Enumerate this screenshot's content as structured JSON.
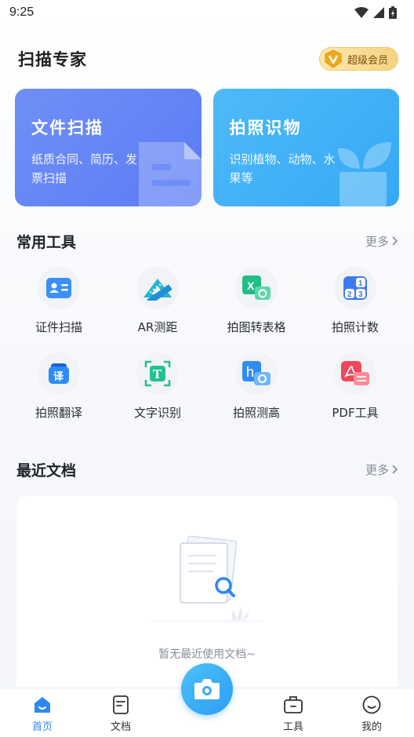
{
  "status_bar": {
    "time": "9:25"
  },
  "header": {
    "title": "扫描专家",
    "vip_label": "超级会员",
    "vip_icon": "v-badge-icon"
  },
  "hero": [
    {
      "title": "文件扫描",
      "desc": "纸质合同、简历、发票扫描"
    },
    {
      "title": "拍照识物",
      "desc": "识别植物、动物、水果等"
    }
  ],
  "tools_section": {
    "title": "常用工具",
    "more": "更多",
    "items": [
      {
        "label": "证件扫描",
        "icon": "id-card-icon"
      },
      {
        "label": "AR测距",
        "icon": "ruler-icon"
      },
      {
        "label": "拍图转表格",
        "icon": "excel-icon"
      },
      {
        "label": "拍照计数",
        "icon": "number-grid-icon"
      },
      {
        "label": "拍照翻译",
        "icon": "translate-icon"
      },
      {
        "label": "文字识别",
        "icon": "text-scan-icon"
      },
      {
        "label": "拍照测高",
        "icon": "height-icon"
      },
      {
        "label": "PDF工具",
        "icon": "pdf-icon"
      }
    ]
  },
  "recent_section": {
    "title": "最近文档",
    "more": "更多",
    "empty_text": "暂无最近使用文档~"
  },
  "tab_bar": {
    "items": [
      {
        "label": "首页",
        "active": true
      },
      {
        "label": "文档",
        "active": false
      },
      {
        "label": "工具",
        "active": false
      },
      {
        "label": "我的",
        "active": false
      }
    ]
  },
  "colors": {
    "accent": "#2f88f4",
    "scan_card": "#5b7cf4",
    "photo_card": "#35a8f6",
    "vip_gold": "#f6d27e"
  }
}
